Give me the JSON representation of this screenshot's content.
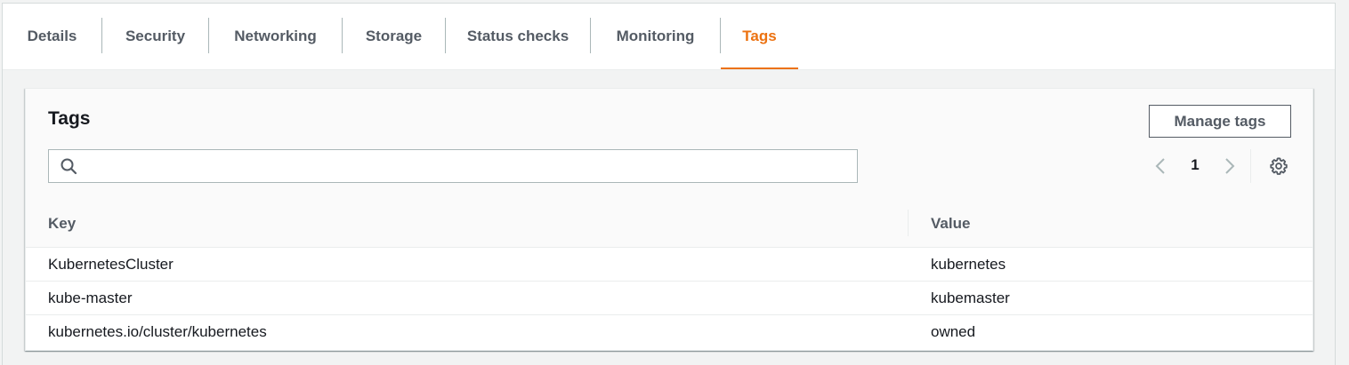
{
  "tabs": [
    {
      "label": "Details",
      "active": false
    },
    {
      "label": "Security",
      "active": false
    },
    {
      "label": "Networking",
      "active": false
    },
    {
      "label": "Storage",
      "active": false
    },
    {
      "label": "Status checks",
      "active": false
    },
    {
      "label": "Monitoring",
      "active": false
    },
    {
      "label": "Tags",
      "active": true
    }
  ],
  "colors": {
    "accent": "#ec7211",
    "text": "#16191f",
    "muted_text": "#545b64"
  },
  "panel": {
    "title": "Tags",
    "manage_button": "Manage tags",
    "search": {
      "value": "",
      "placeholder": "",
      "icon": "search-icon"
    },
    "pagination": {
      "current_page": "1",
      "prev_icon": "chevron-left-icon",
      "next_icon": "chevron-right-icon"
    },
    "settings_icon": "gear-icon"
  },
  "table": {
    "columns": [
      "Key",
      "Value"
    ],
    "rows": [
      {
        "key": "KubernetesCluster",
        "value": "kubernetes"
      },
      {
        "key": "kube-master",
        "value": "kubemaster"
      },
      {
        "key": "kubernetes.io/cluster/kubernetes",
        "value": "owned"
      }
    ]
  }
}
